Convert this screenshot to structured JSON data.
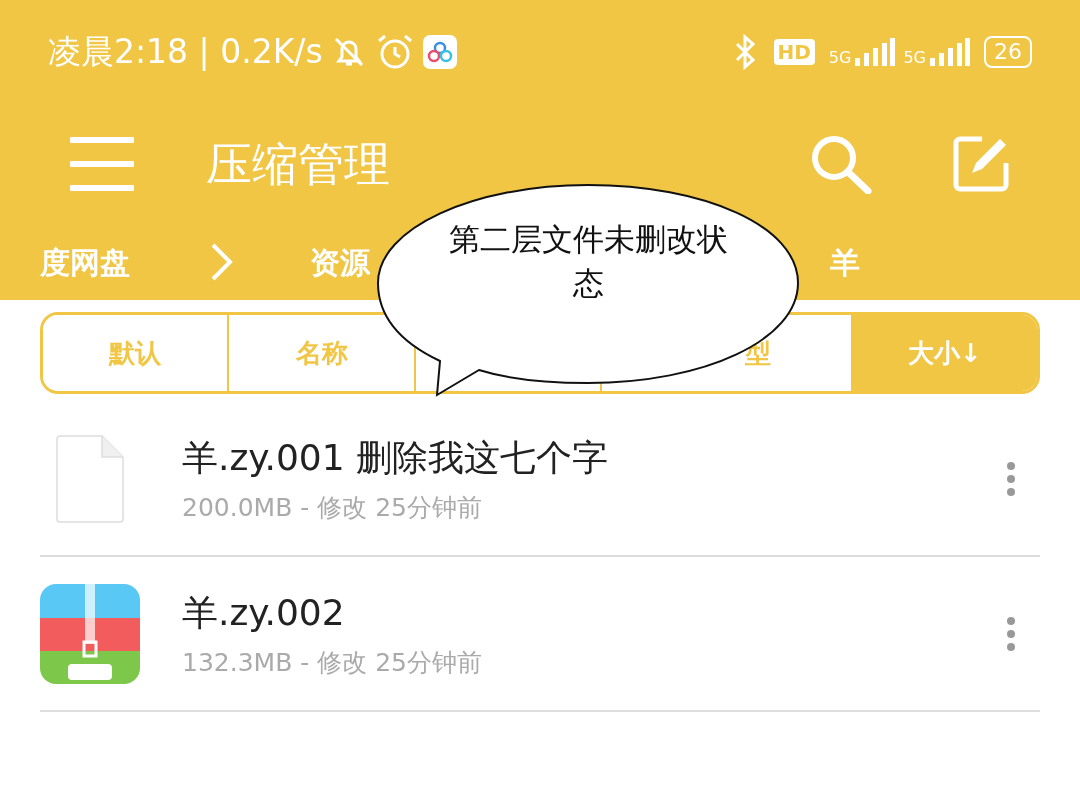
{
  "status_bar": {
    "time_speed": "凌晨2:18 | 0.2K/s",
    "hd": "HD",
    "networks": [
      "5G",
      "5G"
    ],
    "battery": "26"
  },
  "toolbar": {
    "title": "压缩管理"
  },
  "breadcrumb": [
    {
      "label": "度网盘",
      "kind": "crumb"
    },
    {
      "kind": "chevron"
    },
    {
      "label": "资源",
      "kind": "crumb"
    },
    {
      "label": "羊",
      "kind": "crumb"
    }
  ],
  "sort_tabs": [
    {
      "label": "默认",
      "selected": false
    },
    {
      "label": "名称",
      "selected": false
    },
    {
      "selected": false
    },
    {
      "label": "型",
      "selected": false
    },
    {
      "label": "大小↓",
      "selected": true
    }
  ],
  "files": [
    {
      "name": "羊.zy.001 删除我这七个字",
      "meta": "200.0MB - 修改 25分钟前",
      "kind": "generic"
    },
    {
      "name": "羊.zy.002",
      "meta": "132.3MB - 修改 25分钟前",
      "kind": "zip"
    }
  ],
  "callout": {
    "text": "第二层文件未删改状态"
  }
}
